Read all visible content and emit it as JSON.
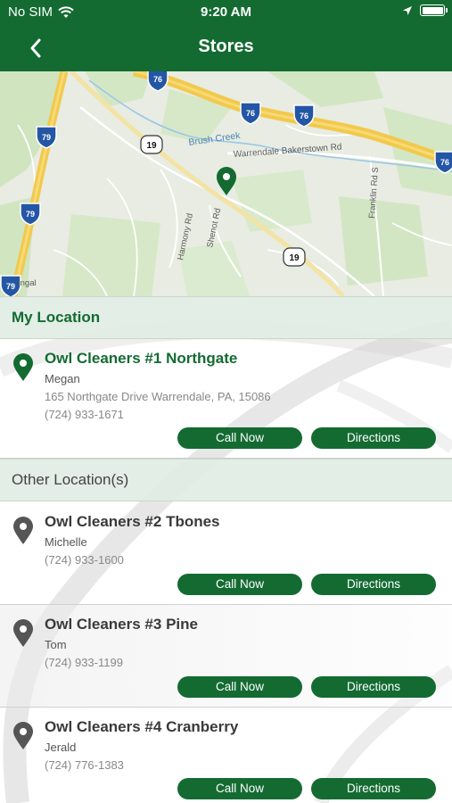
{
  "status_bar": {
    "carrier": "No SIM",
    "time": "9:20 AM"
  },
  "header": {
    "title": "Stores"
  },
  "map": {
    "road_labels": [
      "Warrendale Bakerstown Rd",
      "Brush Creek",
      "Harmony Rd",
      "Shenot Rd",
      "Franklin Rd S",
      "Ingal"
    ],
    "shields": [
      "76",
      "76",
      "76",
      "76",
      "79",
      "79",
      "79",
      "19",
      "19"
    ]
  },
  "sections": {
    "my_location": "My Location",
    "other_locations": "Other Location(s)"
  },
  "my_store": {
    "name": "Owl Cleaners #1 Northgate",
    "contact": "Megan",
    "address": "165 Northgate Drive Warrendale, PA, 15086",
    "phone": "(724) 933-1671",
    "call_label": "Call Now",
    "directions_label": "Directions"
  },
  "other_stores": [
    {
      "name": "Owl Cleaners #2 Tbones",
      "contact": "Michelle",
      "phone": "(724) 933-1600",
      "call_label": "Call Now",
      "directions_label": "Directions"
    },
    {
      "name": "Owl Cleaners #3 Pine",
      "contact": "Tom",
      "phone": "(724) 933-1199",
      "call_label": "Call Now",
      "directions_label": "Directions"
    },
    {
      "name": "Owl Cleaners #4 Cranberry",
      "contact": "Jerald",
      "phone": "(724) 776-1383",
      "call_label": "Call Now",
      "directions_label": "Directions"
    }
  ],
  "colors": {
    "brand": "#146b32",
    "pin_primary": "#146b32",
    "pin_other": "#555555"
  }
}
